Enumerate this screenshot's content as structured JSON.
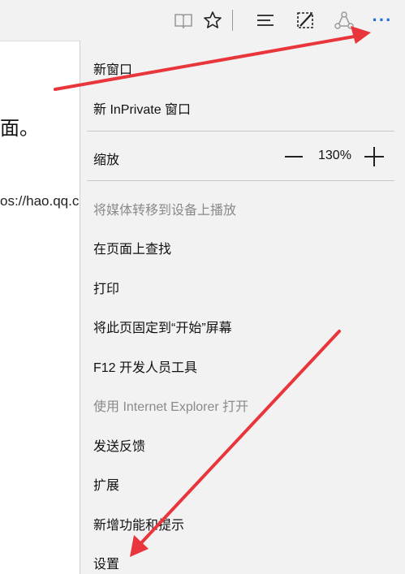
{
  "toolbar": {
    "icons": [
      "reading-view-icon",
      "favorite-star-icon",
      "hub-icon",
      "web-note-icon",
      "share-icon",
      "more-icon"
    ],
    "more_label": "···",
    "accent_color": "#1e6fd9"
  },
  "page": {
    "text_line_1": "面。",
    "text_line_2": "os://hao.qq.c"
  },
  "menu": {
    "new_window": "新窗口",
    "new_inprivate": "新 InPrivate 窗口",
    "zoom_label": "缩放",
    "zoom_value": "130%",
    "cast_media": "将媒体转移到设备上播放",
    "find_on_page": "在页面上查找",
    "print": "打印",
    "pin_to_start": "将此页固定到“开始”屏幕",
    "f12_tools": "F12 开发人员工具",
    "open_with_ie": "使用 Internet Explorer 打开",
    "send_feedback": "发送反馈",
    "extensions": "扩展",
    "whats_new": "新增功能和提示",
    "settings": "设置"
  },
  "annotations": {
    "arrow_color": "#e8363c"
  }
}
